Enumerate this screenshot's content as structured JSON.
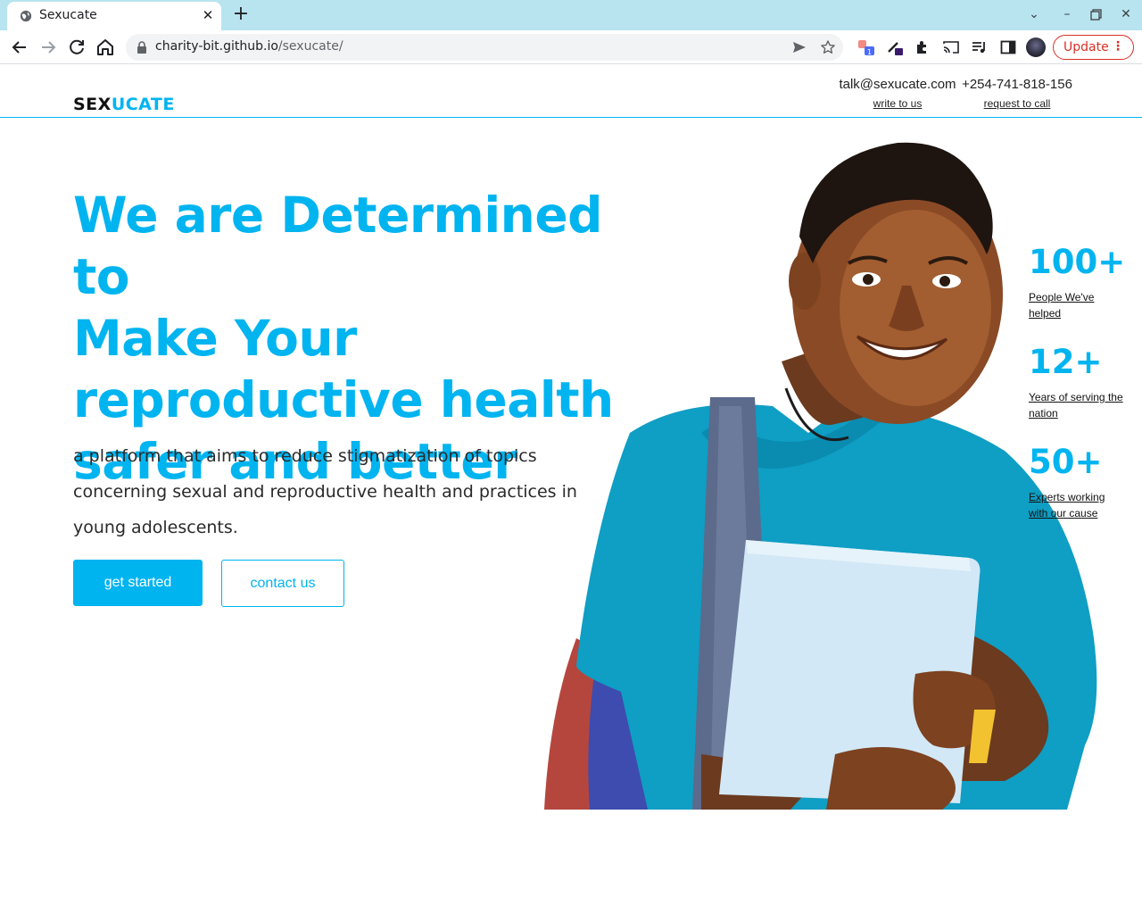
{
  "browser": {
    "tab_title": "Sexucate",
    "url_host": "charity-bit.github.io",
    "url_path": "/sexucate/",
    "update_label": "Update"
  },
  "header": {
    "logo_part1": "SEX",
    "logo_part2": "UCATE",
    "email": "talk@sexucate.com",
    "email_action": "write to us",
    "phone": "+254-741-818-156",
    "phone_action": "request to call"
  },
  "hero": {
    "title_lines": [
      "We are Determined to",
      "Make Your",
      "reproductive health",
      "safer and better"
    ],
    "subtitle": "a platform that aims to reduce stigmatization of topics concerning sexual and reproductive health and practices in young adolescents.",
    "primary_button": "get started",
    "secondary_button": "contact us"
  },
  "stats": [
    {
      "value": "100+",
      "label": "People We've helped"
    },
    {
      "value": "12+",
      "label": "Years of serving the nation"
    },
    {
      "value": "50+",
      "label": "Experts working with our cause"
    }
  ],
  "colors": {
    "accent": "#00b4f0",
    "tab_bar": "#b8e4f0",
    "update": "#d93025"
  }
}
